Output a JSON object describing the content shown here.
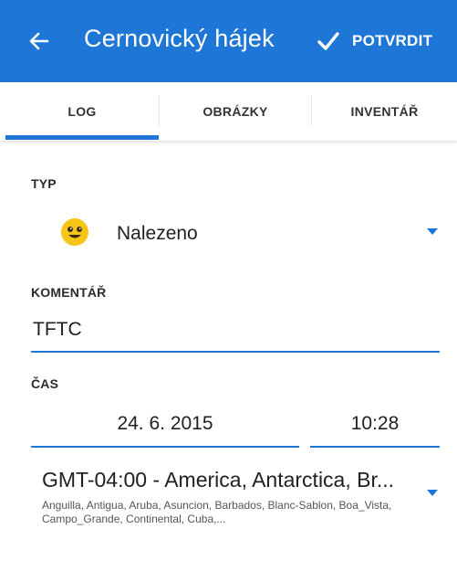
{
  "appbar": {
    "title": "Cernovický hájek",
    "confirm_label": "POTVRDIT",
    "color": "#1e77d6"
  },
  "tabs": [
    {
      "label": "LOG",
      "active": true
    },
    {
      "label": "OBRÁZKY",
      "active": false
    },
    {
      "label": "INVENTÁŘ",
      "active": false
    }
  ],
  "form": {
    "type_label": "TYP",
    "type_value": "Nalezeno",
    "type_icon": "smiley-found-icon",
    "comment_label": "KOMENTÁŘ",
    "comment_value": "TFTC",
    "time_label": "ČAS",
    "date_value": "24. 6. 2015",
    "time_value": "10:28",
    "timezone_title": "GMT-04:00 - America, Antarctica, Br...",
    "timezone_desc": "Anguilla, Antigua, Aruba, Asuncion, Barbados, Blanc-Sablon, Boa_Vista, Campo_Grande, Continental, Cuba,..."
  }
}
